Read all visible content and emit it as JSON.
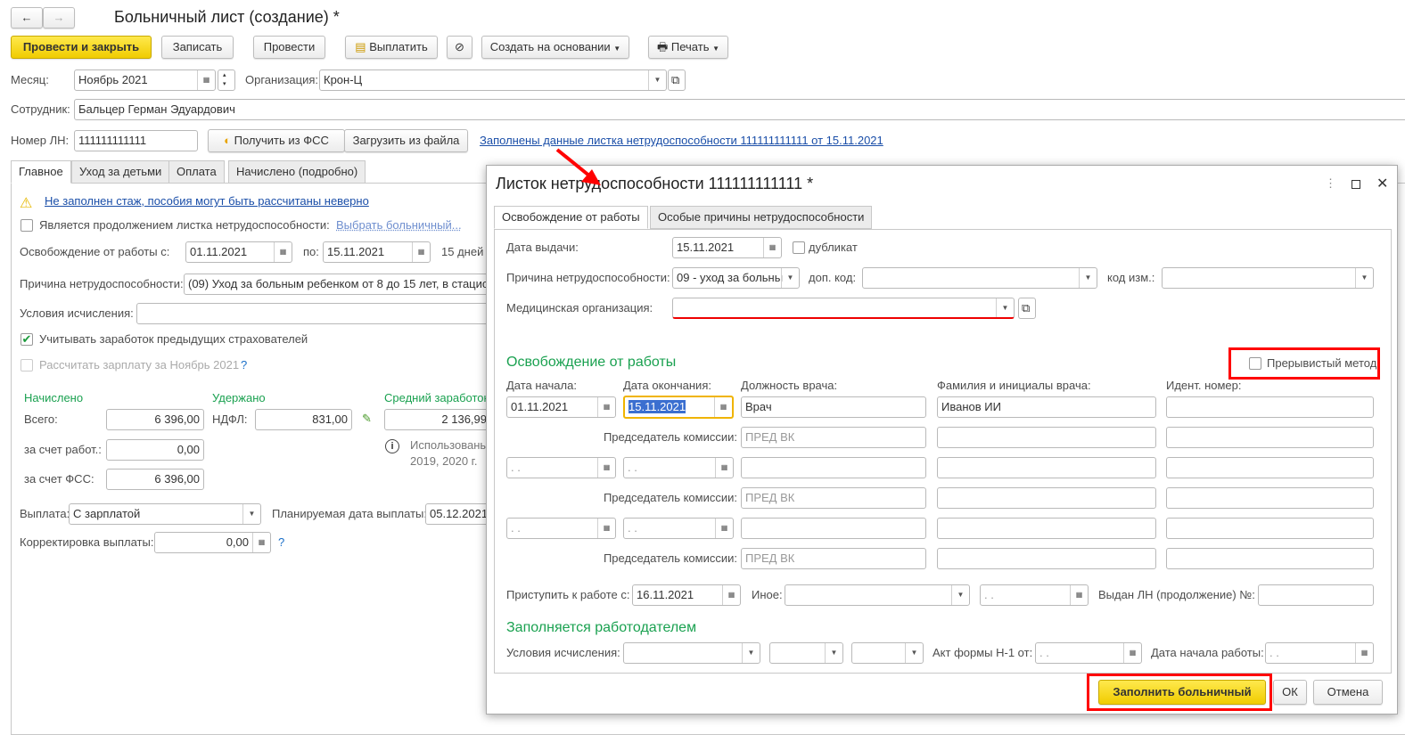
{
  "window": {
    "title": "Больничный лист (создание) *",
    "back": "←",
    "forward": "→"
  },
  "toolbar": {
    "post_close": "Провести и закрыть",
    "save": "Записать",
    "post": "Провести",
    "pay": "Выплатить",
    "create_based": "Создать на основании",
    "print": "Печать"
  },
  "header": {
    "month_label": "Месяц:",
    "month": "Ноябрь 2021",
    "org_label": "Организация:",
    "org": "Крон-Ц",
    "employee_label": "Сотрудник:",
    "employee": "Бальцер Герман Эдуардович",
    "ln_label": "Номер ЛН:",
    "ln": "111111111111",
    "get_fss": "Получить из ФСС",
    "load_file": "Загрузить из файла",
    "filled_link": "Заполнены данные листка нетрудоспособности 111111111111 от 15.11.2021"
  },
  "tabs": [
    "Главное",
    "Уход за детьми",
    "Оплата",
    "Начислено (подробно)"
  ],
  "main": {
    "warning": "Не заполнен стаж, пособия могут быть рассчитаны неверно",
    "continuation": "Является продолжением листка нетрудоспособности:",
    "choose_sick": "Выбрать больничный...",
    "release_label": "Освобождение от работы с:",
    "release_from": "01.11.2021",
    "to_label": "по:",
    "release_to": "15.11.2021",
    "days": "15 дней",
    "reason_label": "Причина нетрудоспособности:",
    "reason": "(09) Уход за больным ребенком от 8 до 15 лет, в стацио",
    "cond_label": "Условия исчисления:",
    "cond": "",
    "prev_insurers": "Учитывать заработок предыдущих страхователей",
    "prev_insurers_checked": true,
    "calc_salary": "Рассчитать зарплату за Ноябрь 2021",
    "help": "?",
    "accrued_h": "Начислено",
    "withheld_h": "Удержано",
    "avg_h": "Средний заработок",
    "total_label": "Всего:",
    "total": "6 396,00",
    "ndfl_label": "НДФЛ:",
    "ndfl": "831,00",
    "avg": "2 136,99",
    "employer_label": "за счет работ.:",
    "employer": "0,00",
    "fss_label": "за счет ФСС:",
    "fss": "6 396,00",
    "info1": "Использованы",
    "info2": "2019,  2020 г.",
    "payout_label": "Выплата:",
    "payout": "С зарплатой",
    "plan_date_label": "Планируемая дата выплаты:",
    "plan_date": "05.12.2021",
    "corr_label": "Корректировка выплаты:",
    "corr": "0,00"
  },
  "dialog": {
    "title": "Листок нетрудоспособности 111111111111 *",
    "tabs": [
      "Освобождение от работы",
      "Особые причины нетрудоспособности"
    ],
    "issue_label": "Дата выдачи:",
    "issue": "15.11.2021",
    "duplicate": "дубликат",
    "reason_label": "Причина нетрудоспособности:",
    "reason": "09 - уход за больны",
    "extra_label": "доп. код:",
    "change_label": "код изм.:",
    "med_label": "Медицинская организация:",
    "release_h": "Освобождение от работы",
    "intermittent": "Прерывистый метод",
    "cols": [
      "Дата начала:",
      "Дата окончания:",
      "Должность врача:",
      "Фамилия и инициалы врача:",
      "Идент.  номер:"
    ],
    "row1": {
      "start": "01.11.2021",
      "end": "15.11.2021",
      "position": "Врач",
      "doctor": "Иванов ИИ"
    },
    "chair_label": "Председатель комиссии:",
    "chair_ph": "ПРЕД ВК",
    "empty_date": " .  .",
    "return_label": "Приступить к работе с:",
    "return": "16.11.2021",
    "other_label": "Иное:",
    "issued_label": "Выдан ЛН (продолжение) №:",
    "employer_h": "Заполняется работодателем",
    "cond_label": "Условия исчисления:",
    "act_label": "Акт формы Н-1 от:",
    "work_start_label": "Дата начала работы:",
    "fill": "Заполнить больничный",
    "ok": "ОК",
    "cancel": "Отмена"
  },
  "colors": {
    "accent_yellow": "#f5d400",
    "section_green": "#1aa150",
    "highlight_red": "#ff0000",
    "link": "#1a4ea8"
  }
}
